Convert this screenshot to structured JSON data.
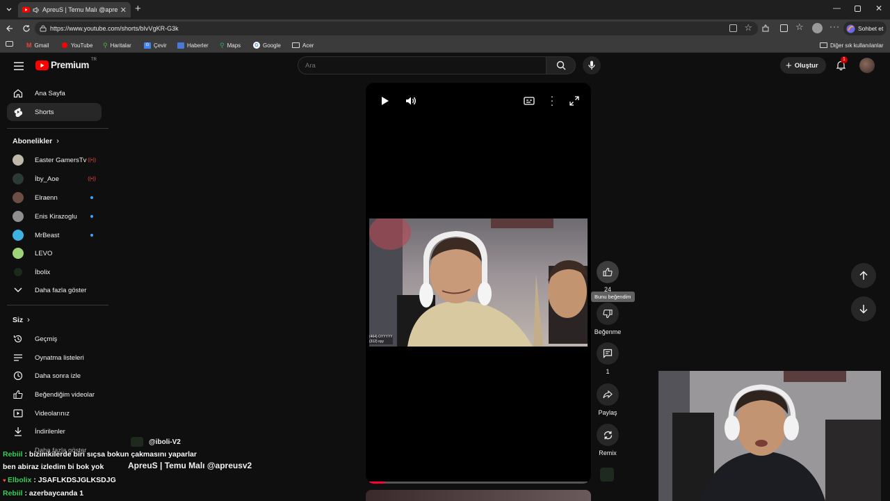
{
  "browser": {
    "tab_title": "ApreuS | Temu Malı @apreusv",
    "url": "https://www.youtube.com/shorts/bIvVgKR-G3k",
    "copilot_label": "Sohbet et",
    "bookmarks": [
      "Gmail",
      "YouTube",
      "Haritalar",
      "Çevir",
      "Haberler",
      "Maps",
      "Google",
      "Acer"
    ],
    "other_bookmarks": "Diğer sık kullanılanlar"
  },
  "header": {
    "logo_text": "Premium",
    "logo_badge": "TR",
    "search_placeholder": "Ara",
    "create_label": "Oluştur",
    "notif_count": "1"
  },
  "sidebar": {
    "main": [
      {
        "label": "Ana Sayfa",
        "icon": "home-icon"
      },
      {
        "label": "Shorts",
        "icon": "shorts-icon"
      }
    ],
    "subs_title": "Abonelikler",
    "subs": [
      {
        "label": "Easter GamersTv",
        "status": "live"
      },
      {
        "label": "İby_Aoe",
        "status": "live"
      },
      {
        "label": "Elraenn",
        "status": "new"
      },
      {
        "label": "Enis Kirazoglu",
        "status": "new"
      },
      {
        "label": "MrBeast",
        "status": "new"
      },
      {
        "label": "LEVO",
        "status": ""
      },
      {
        "label": "İbolix",
        "status": ""
      }
    ],
    "show_more": "Daha fazla göster",
    "you_title": "Siz",
    "you": [
      {
        "label": "Geçmiş",
        "icon": "history-icon"
      },
      {
        "label": "Oynatma listeleri",
        "icon": "playlist-icon"
      },
      {
        "label": "Daha sonra izle",
        "icon": "clock-icon"
      },
      {
        "label": "Beğendiğim videolar",
        "icon": "like-icon"
      },
      {
        "label": "Videolarınız",
        "icon": "video-icon"
      },
      {
        "label": "İndirilenler",
        "icon": "download-icon"
      }
    ],
    "you_show_more": "Daha fazla göster"
  },
  "short": {
    "channel": "@iboli-V2",
    "title": "ApreuS | Temu Malı @apreusv2",
    "overlay_line1": "(464) OYYYYY",
    "overlay_line2": "(312) oyy",
    "progress": 0.07
  },
  "actions": {
    "like_count": "24",
    "like_tooltip": "Bunu beğendim",
    "dislike_label": "Beğenme",
    "comment_count": "1",
    "share_label": "Paylaş",
    "remix_label": "Remix"
  },
  "chat": [
    {
      "name": "Rebiil",
      "text": " : bizimkilerde biri sıçsa bokun çakmasını yaparlar"
    },
    {
      "name": "",
      "text": "ben abiraz izledim bi bok yok"
    },
    {
      "name": "Elbolix",
      "text": " : JSAFLKDSJGLKSDJG"
    },
    {
      "name": "Rebiil",
      "text": " : azerbaycanda 1"
    }
  ]
}
